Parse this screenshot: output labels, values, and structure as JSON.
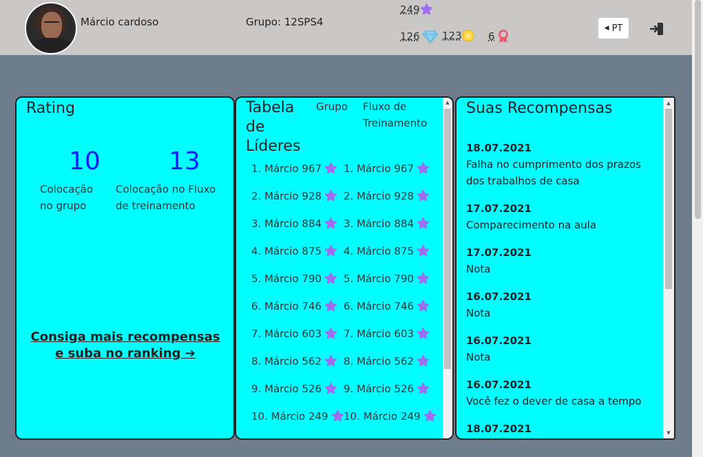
{
  "header": {
    "user_name": "Márcio cardoso",
    "group": "Grupo: 12SPS4",
    "stats": {
      "stars": "249",
      "diamonds": "126",
      "coins": "123",
      "badges": "6"
    },
    "lang": "PT"
  },
  "rating": {
    "title": "Rating",
    "group_rank": "10",
    "group_rank_label": "Colocação no grupo",
    "stream_rank": "13",
    "stream_rank_label": "Colocação no Fluxo de treinamento",
    "link": "Consiga mais recompensas e suba no ranking  ➔"
  },
  "leaderboard": {
    "title": "Tabela de Líderes",
    "tab_group": "Grupo",
    "tab_stream": "Fluxo de Treinamento",
    "group_rows": [
      "1. Márcio 967",
      "2. Márcio 928",
      "3. Márcio 884",
      "4. Márcio 875",
      "5. Márcio 790",
      "6. Márcio 746",
      "7. Márcio 603",
      "8. Márcio 562",
      "9. Márcio 526",
      "10. Márcio 249"
    ],
    "stream_rows": [
      "1. Márcio 967",
      "2. Márcio 928",
      "3. Márcio 884",
      "4. Márcio 875",
      "5. Márcio 790",
      "6. Márcio 746",
      "7. Márcio 603",
      "8. Márcio 562",
      "9. Márcio 526",
      "10. Márcio 249"
    ]
  },
  "rewards": {
    "title": "Suas Recompensas",
    "items": [
      {
        "date": "18.07.2021",
        "text": "Falha no cumprimento dos prazos dos trabalhos de casa"
      },
      {
        "date": "17.07.2021",
        "text": "Comparecimento na aula"
      },
      {
        "date": "17.07.2021",
        "text": "Nota"
      },
      {
        "date": "16.07.2021",
        "text": "Nota"
      },
      {
        "date": "16.07.2021",
        "text": "Nota"
      },
      {
        "date": "16.07.2021",
        "text": "Você fez o dever de casa a tempo"
      },
      {
        "date": "18.07.2021",
        "text": ""
      }
    ]
  },
  "colors": {
    "panel_bg": "#00ffff",
    "page_bg": "#6e7b8b",
    "header_bg": "#cac8c6",
    "rank_blue": "#1a1aff",
    "star_purple": "#a06cf0"
  },
  "icons": {
    "star": "star-icon",
    "diamond": "diamond-icon",
    "coin": "coin-icon",
    "badge": "badge-icon",
    "logout": "logout-icon",
    "caret": "caret-left-icon"
  }
}
